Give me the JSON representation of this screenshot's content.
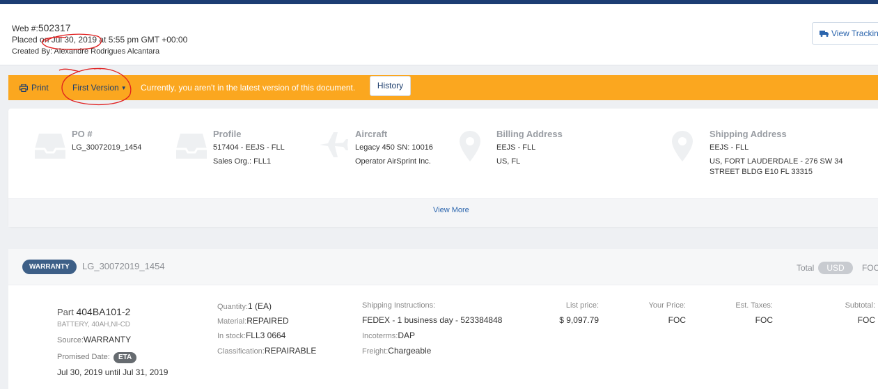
{
  "header": {
    "web_label": "Web #:",
    "web_number": "502317",
    "placed": "Placed on Jul 30, 2019 at 5:55 pm GMT +00:00",
    "created_by": "Created By: Alexandre Rodrigues Alcantara",
    "tracking_button": "View Tracking"
  },
  "version_bar": {
    "print_label": "Print",
    "version_label": "First Version",
    "notice": "Currently, you aren't in the latest version of this document.",
    "history_button": "History",
    "background_color": "#fba71f"
  },
  "info": {
    "po": {
      "title": "PO #",
      "line1": "LG_30072019_1454"
    },
    "profile": {
      "title": "Profile",
      "line1": "517404 - EEJS - FLL",
      "line2": "Sales Org.: FLL1"
    },
    "aircraft": {
      "title": "Aircraft",
      "line1": "Legacy 450 SN: 10016",
      "line2": "Operator AirSprint Inc."
    },
    "billing": {
      "title": "Billing Address",
      "line1": "EEJS - FLL",
      "line2": "US, FL"
    },
    "shipping": {
      "title": "Shipping Address",
      "line1": "EEJS - FLL",
      "line2": "US, FORT LAUDERDALE - 276 SW 34",
      "line3": "STREET BLDG E10 FL 33315"
    },
    "view_more": "View More"
  },
  "order": {
    "badge": "WARRANTY",
    "id": "LG_30072019_1454",
    "total_label": "Total",
    "currency": "USD",
    "total_value": "FOC",
    "item": {
      "part_label": "Part",
      "part_number": "404BA101-2",
      "description": "BATTERY, 40AH,NI-CD",
      "source_label": "Source:",
      "source_value": "WARRANTY",
      "promised_label": "Promised Date:",
      "eta": "ETA",
      "dates": "Jul 30, 2019 until Jul 31, 2019",
      "quantity_label": "Quantity:",
      "quantity_value": "1 (EA)",
      "material_label": "Material:",
      "material_value": "REPAIRED",
      "instock_label": "In stock:",
      "instock_value": "FLL3 0664",
      "classification_label": "Classification:",
      "classification_value": "REPAIRABLE",
      "shipping_instructions_label": "Shipping Instructions:",
      "shipping_instructions_value": "FEDEX - 1 business day - 523384848",
      "incoterms_label": "Incoterms:",
      "incoterms_value": "DAP",
      "freight_label": "Freight:",
      "freight_value": "Chargeable",
      "list_price_label": "List price:",
      "list_price_value": "$ 9,097.79",
      "your_price_label": "Your Price:",
      "your_price_value": "FOC",
      "est_taxes_label": "Est. Taxes:",
      "est_taxes_value": "FOC",
      "subtotal_label": "Subtotal:",
      "subtotal_value": "FOC"
    }
  },
  "colors": {
    "top_bar": "#1c3d73",
    "link": "#2a64ad",
    "badge": "#3d5f87"
  },
  "icons": [
    "truck-icon",
    "print-icon",
    "caret-down-icon",
    "inbox-icon",
    "airplane-icon",
    "map-pin-icon"
  ]
}
